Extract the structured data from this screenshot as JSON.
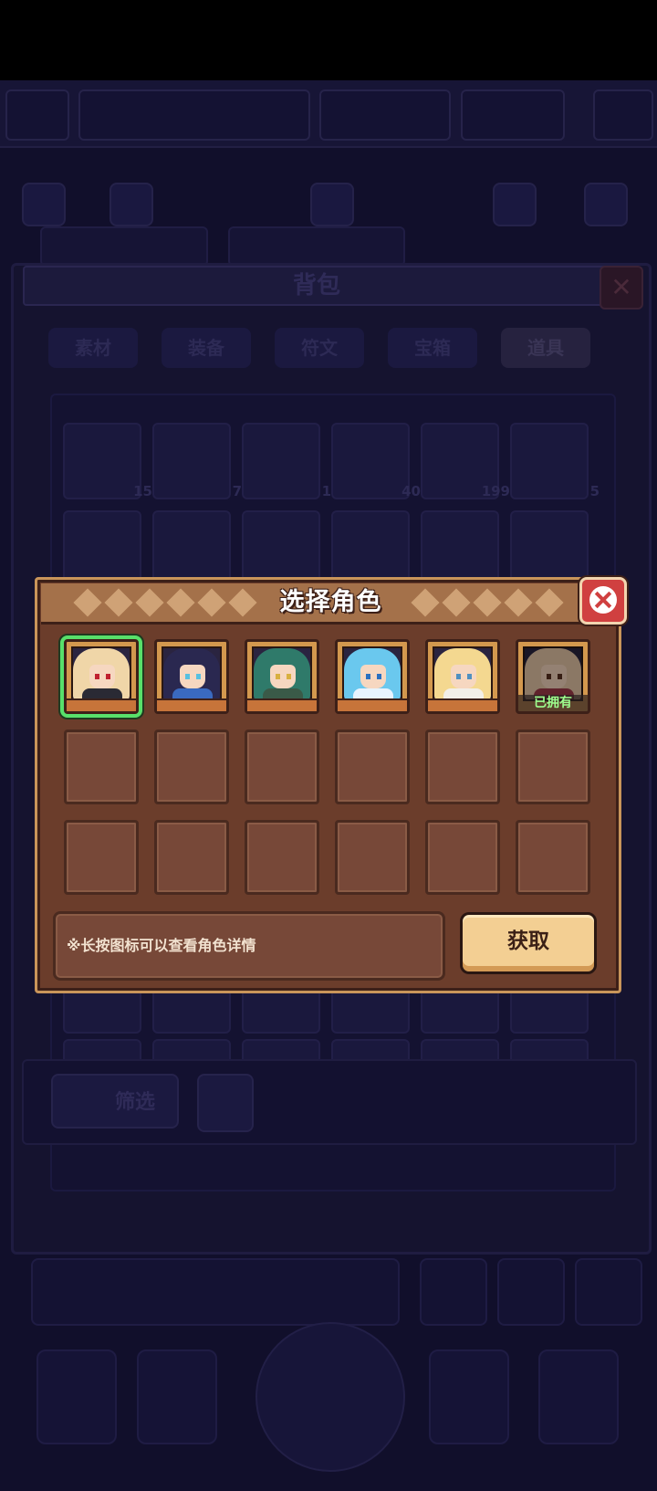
{
  "background": {
    "bag_title": "背包",
    "tabs": [
      "素材",
      "装备",
      "符文",
      "宝箱",
      "道具"
    ],
    "active_tab_index": 4,
    "item_counts": [
      "15",
      "7",
      "1",
      "40",
      "199",
      "5"
    ],
    "filter_label": "筛选"
  },
  "modal": {
    "title": "选择角色",
    "hint": "※长按图标可以查看角色详情",
    "acquire_label": "获取",
    "owned_label": "已拥有",
    "characters": [
      {
        "id": "char-1",
        "hair": "#f0d6a8",
        "outfit": "#2a2a34",
        "eye": "#c02030",
        "selected": true,
        "owned": false
      },
      {
        "id": "char-2",
        "hair": "#2a2850",
        "outfit": "#3a6ac0",
        "eye": "#58c0e0",
        "selected": false,
        "owned": false
      },
      {
        "id": "char-3",
        "hair": "#2f7a6a",
        "outfit": "#3a5a48",
        "eye": "#d8b040",
        "selected": false,
        "owned": false
      },
      {
        "id": "char-4",
        "hair": "#6ac8ee",
        "outfit": "#e8f4ff",
        "eye": "#2a70c0",
        "selected": false,
        "owned": false
      },
      {
        "id": "char-5",
        "hair": "#f4d890",
        "outfit": "#f2efe8",
        "eye": "#5090c0",
        "selected": false,
        "owned": false
      },
      {
        "id": "char-6",
        "hair": "#e8c8a8",
        "outfit": "#a03a4a",
        "eye": "#5a3020",
        "selected": false,
        "owned": true
      }
    ],
    "empty_slots": 12,
    "colors": {
      "frame": "#c9955a",
      "panel": "#6b3d2b",
      "slot": "#774838",
      "select": "#58e06a",
      "close": "#d04040",
      "button": "#f3cf93"
    }
  }
}
